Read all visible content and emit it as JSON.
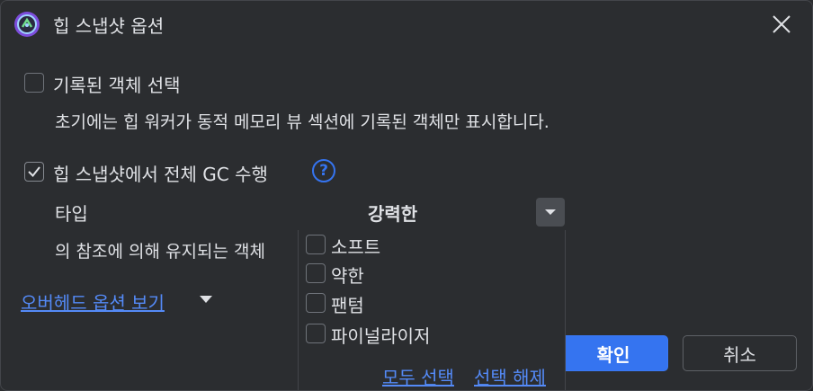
{
  "window": {
    "title": "힙 스냅샷 옵션",
    "app_icon": "android-studio-icon",
    "close_icon": "close-icon"
  },
  "recorded_objects": {
    "label": "기록된 객체 선택",
    "checked": false,
    "description": "초기에는 힙 워커가 동적 메모리 뷰 섹션에 기록된 객체만 표시합니다."
  },
  "full_gc": {
    "label": "힙 스냅샷에서 전체 GC 수행",
    "checked": true,
    "help_icon": "?",
    "type_label": "타입",
    "type_value": "강력한",
    "retained_text": "의 참조에 의해 유지되는 객체"
  },
  "reference_popup": {
    "items": [
      {
        "label": "소프트",
        "checked": false
      },
      {
        "label": "약한",
        "checked": false
      },
      {
        "label": "팬텀",
        "checked": false
      },
      {
        "label": "파이널라이저",
        "checked": false
      }
    ],
    "select_all": "모두 선택",
    "deselect": "선택 해제"
  },
  "overhead_link": "오버헤드 옵션 보기",
  "buttons": {
    "ok": "확인",
    "cancel": "취소"
  },
  "colors": {
    "background": "#2b2d30",
    "accent": "#3574f0",
    "link": "#548af7",
    "text": "#dfe1e5"
  }
}
